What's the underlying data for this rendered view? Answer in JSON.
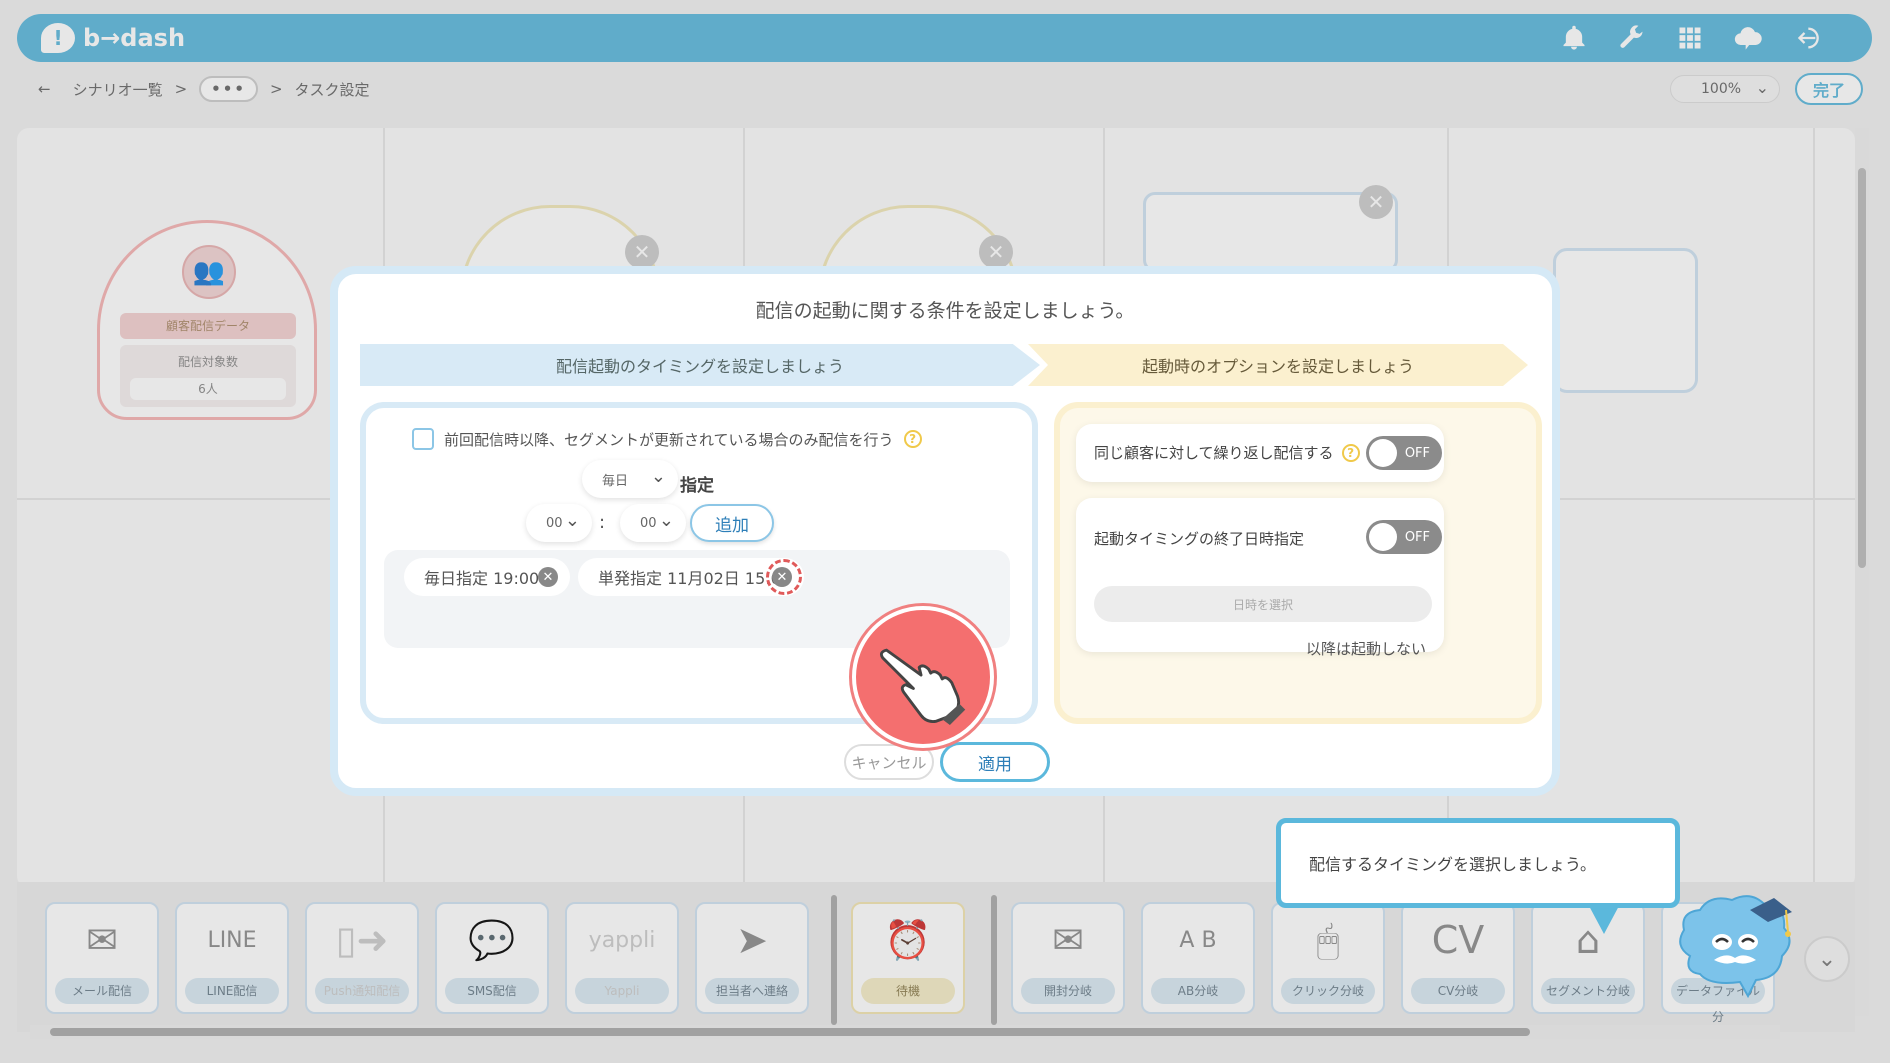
{
  "header": {
    "logo_text": "b→dash",
    "icons": [
      "bell-icon",
      "wrench-icon",
      "grid-icon",
      "notification-cloud-icon",
      "logout-icon"
    ],
    "accent_color": "#5bb8dc"
  },
  "breadcrumb": {
    "back": "←",
    "scenario_list": "シナリオ一覧",
    "sep1": ">",
    "ellipsis": "•••",
    "sep2": ">",
    "current": "タスク設定"
  },
  "toolbar": {
    "zoom": "100%",
    "done_label": "完了"
  },
  "canvas": {
    "start_node": {
      "label": "顧客配信データ",
      "count_label": "配信対象数",
      "count_value": "6人"
    }
  },
  "palette": [
    {
      "icon": "envelope-icon",
      "glyph": "✉",
      "label": "メール配信"
    },
    {
      "icon": "line-icon",
      "glyph": "LINE",
      "label": "LINE配信"
    },
    {
      "icon": "push-icon",
      "glyph": "▯➜",
      "label": "Push通知配信"
    },
    {
      "icon": "sms-icon",
      "glyph": "💬",
      "label": "SMS配信"
    },
    {
      "icon": "yappli-icon",
      "glyph": "yappli",
      "label": "Yappli"
    },
    {
      "icon": "paper-plane-icon",
      "glyph": "➤",
      "label": "担当者へ連絡"
    },
    {
      "icon": "alarm-clock-icon",
      "glyph": "⏰",
      "label": "待機"
    },
    {
      "icon": "open-mail-icon",
      "glyph": "✉",
      "label": "開封分岐"
    },
    {
      "icon": "ab-icon",
      "glyph": "A B",
      "label": "AB分岐"
    },
    {
      "icon": "mouse-click-icon",
      "glyph": "🖱",
      "label": "クリック分岐"
    },
    {
      "icon": "cv-icon",
      "glyph": "CV",
      "label": "CV分岐"
    },
    {
      "icon": "segment-icon",
      "glyph": "⌂",
      "label": "セグメント分岐"
    },
    {
      "icon": "datafile-icon",
      "glyph": "",
      "label": "データファイル分"
    }
  ],
  "modal": {
    "title": "配信の起動に関する条件を設定しましょう。",
    "step1": "配信起動のタイミングを設定しましょう",
    "step2": "起動時のオプションを設定しましょう",
    "left": {
      "checkbox_label": "前回配信時以降、セグメントが更新されている場合のみ配信を行う",
      "help": "?",
      "frequency": "毎日",
      "frequency_suffix": "指定",
      "hour": "00",
      "colon": ":",
      "minute": "00",
      "add_label": "追加",
      "chips": [
        {
          "label": "毎日指定 19:00"
        },
        {
          "label": "単発指定 11月02日 15:00"
        }
      ],
      "chip_remove": "✕"
    },
    "right": {
      "repeat_label": "同じ顧客に対して繰り返し配信する",
      "repeat_help": "?",
      "repeat_toggle": "OFF",
      "end_label": "起動タイミングの終了日時指定",
      "end_toggle": "OFF",
      "date_placeholder": "日時を選択",
      "after_label": "以降は起動しない"
    },
    "cancel_label": "キャンセル",
    "apply_label": "適用"
  },
  "tooltip": {
    "text": "配信するタイミングを選択しましょう。"
  }
}
